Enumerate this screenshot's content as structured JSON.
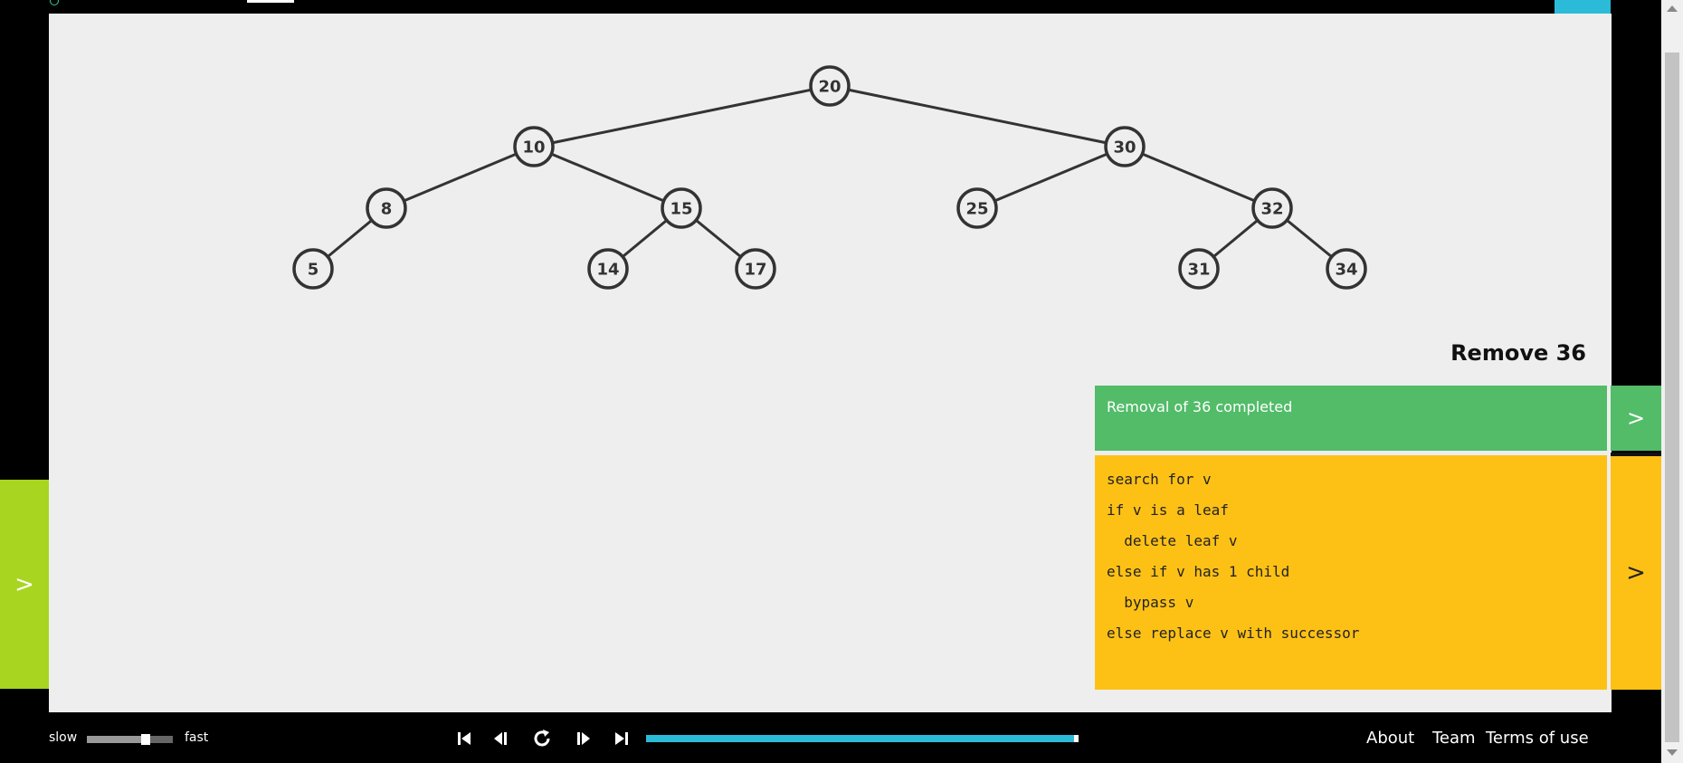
{
  "tree": {
    "nodes": [
      {
        "label": "20"
      },
      {
        "label": "10"
      },
      {
        "label": "30"
      },
      {
        "label": "8"
      },
      {
        "label": "15"
      },
      {
        "label": "25"
      },
      {
        "label": "32"
      },
      {
        "label": "5"
      },
      {
        "label": "14"
      },
      {
        "label": "17"
      },
      {
        "label": "31"
      },
      {
        "label": "34"
      }
    ],
    "edges": [
      [
        "20",
        "10"
      ],
      [
        "20",
        "30"
      ],
      [
        "10",
        "8"
      ],
      [
        "10",
        "15"
      ],
      [
        "30",
        "25"
      ],
      [
        "30",
        "32"
      ],
      [
        "8",
        "5"
      ],
      [
        "15",
        "14"
      ],
      [
        "15",
        "17"
      ],
      [
        "32",
        "31"
      ],
      [
        "32",
        "34"
      ]
    ]
  },
  "operation": {
    "title": "Remove 36"
  },
  "status": {
    "message": "Removal of 36 completed",
    "arrow": ">"
  },
  "pseudocode": {
    "lines": [
      "search for v",
      "if v is a leaf",
      "  delete leaf v",
      "else if v has 1 child",
      "  bypass v",
      "else replace v with successor"
    ],
    "arrow": ">"
  },
  "left_panel": {
    "arrow": ">"
  },
  "speed": {
    "slow_label": "slow",
    "fast_label": "fast",
    "level": 0.68
  },
  "playback": {
    "progress": 1.0
  },
  "footer": {
    "about": "About",
    "team": "Team",
    "terms": "Terms of use"
  },
  "colors": {
    "canvas_bg": "#eeeeee",
    "status_green": "#52bc69",
    "code_yellow": "#fdc116",
    "accent_cyan": "#2bbbd8",
    "left_tab_green": "#a8d51f",
    "node_stroke": "#333333"
  }
}
